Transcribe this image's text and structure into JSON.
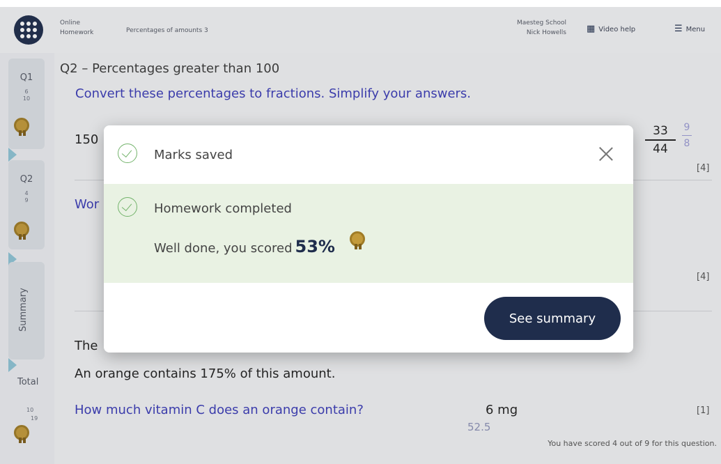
{
  "topbar": {
    "online_homework": "Online Homework",
    "assignment_title": "Percentages of amounts 3",
    "school": "Maesteg School",
    "student": "Nick Howells",
    "video_help": "Video help",
    "menu": "Menu"
  },
  "rail": {
    "q1": {
      "label": "Q1",
      "score": "6",
      "max": "10"
    },
    "q2": {
      "label": "Q2",
      "score": "4",
      "max": "9"
    },
    "summary": "Summary",
    "total": {
      "label": "Total",
      "score": "10",
      "max": "19"
    }
  },
  "question": {
    "title": "Q2 – Percentages greater than 100",
    "instruction": "Convert these percentages to fractions. Simplify your answers.",
    "row_prefix": "150",
    "fraction_num": "33",
    "fraction_den": "44",
    "answer_num": "9",
    "answer_den": "8",
    "mark_1": "[4]",
    "word_prefix": "Wor",
    "mark_2": "[4]",
    "the_prefix": "The",
    "orange_text": "An orange contains 175% of this amount.",
    "how_much": "How much vitamin C does an orange contain?",
    "student_answer": "6 mg",
    "correct_answer": "52.5",
    "mark_3": "[1]",
    "scored_text": "You have scored 4 out of 9 for this question."
  },
  "modal": {
    "marks_saved": "Marks saved",
    "completed": "Homework completed",
    "well_done": "Well done, you scored",
    "percent": "53%",
    "see_summary": "See summary"
  }
}
